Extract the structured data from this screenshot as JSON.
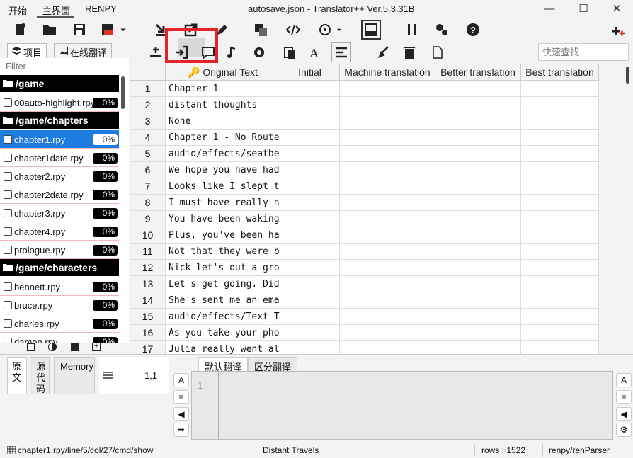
{
  "menu": {
    "items": [
      "开始",
      "主界面",
      "RENPY"
    ]
  },
  "window": {
    "title": "autosave.json - Translator++ Ver.5.3.31B"
  },
  "left_tabs": {
    "project": "项目",
    "online": "在线翻译"
  },
  "filter_placeholder": "Filter",
  "folders": [
    {
      "name": "/game",
      "files": [
        {
          "name": "00auto-highlight.rpy",
          "pct": "0%"
        }
      ]
    },
    {
      "name": "/game/chapters",
      "files": [
        {
          "name": "chapter1.rpy",
          "pct": "0%",
          "selected": true
        },
        {
          "name": "chapter1date.rpy",
          "pct": "0%"
        },
        {
          "name": "chapter2.rpy",
          "pct": "0%"
        },
        {
          "name": "chapter2date.rpy",
          "pct": "0%"
        },
        {
          "name": "chapter3.rpy",
          "pct": "0%"
        },
        {
          "name": "chapter4.rpy",
          "pct": "0%"
        },
        {
          "name": "prologue.rpy",
          "pct": "0%"
        }
      ]
    },
    {
      "name": "/game/characters",
      "files": [
        {
          "name": "bennett.rpy",
          "pct": "0%"
        },
        {
          "name": "bruce.rpy",
          "pct": "0%"
        },
        {
          "name": "charles.rpy",
          "pct": "0%"
        },
        {
          "name": "damon.rpy",
          "pct": "0%"
        }
      ]
    }
  ],
  "quick_search_placeholder": "快速查找",
  "grid": {
    "columns": [
      "Original Text",
      "Initial",
      "Machine translation",
      "Better translation",
      "Best translation"
    ],
    "rows": [
      [
        "1",
        "Chapter 1"
      ],
      [
        "2",
        "distant thoughts"
      ],
      [
        "3",
        "None"
      ],
      [
        "4",
        "Chapter 1 - No Route"
      ],
      [
        "5",
        "audio/effects/seatbelt"
      ],
      [
        "6",
        "We hope you have had a"
      ],
      [
        "7",
        "Looks like I slept thr"
      ],
      [
        "8",
        "I must have really nee"
      ],
      [
        "9",
        "You have been waking u"
      ],
      [
        "10",
        "Plus, you've been havi"
      ],
      [
        "11",
        "Not that they were bad"
      ],
      [
        "12",
        "Nick let's out a groan"
      ],
      [
        "13",
        "Let's get going. Did I"
      ],
      [
        "14",
        "She's sent me an email"
      ],
      [
        "15",
        "audio/effects/Text_Ton"
      ],
      [
        "16",
        "As you take your phone"
      ],
      [
        "17",
        "Julia really went all"
      ]
    ]
  },
  "bottom": {
    "tabs": [
      "原文",
      "源代码",
      "Memory"
    ],
    "position": "1,1",
    "trans_tabs": [
      "默认翻译",
      "区分翻译"
    ],
    "line_no": "1"
  },
  "status": {
    "path": "chapter1.rpy/line/5/col/27/cmd/show",
    "title": "Distant Travels",
    "rows": "rows : 1522",
    "parser": "renpy/renParser"
  },
  "colors": {
    "highlight": "#e8202a",
    "selected": "#1e7be0"
  }
}
